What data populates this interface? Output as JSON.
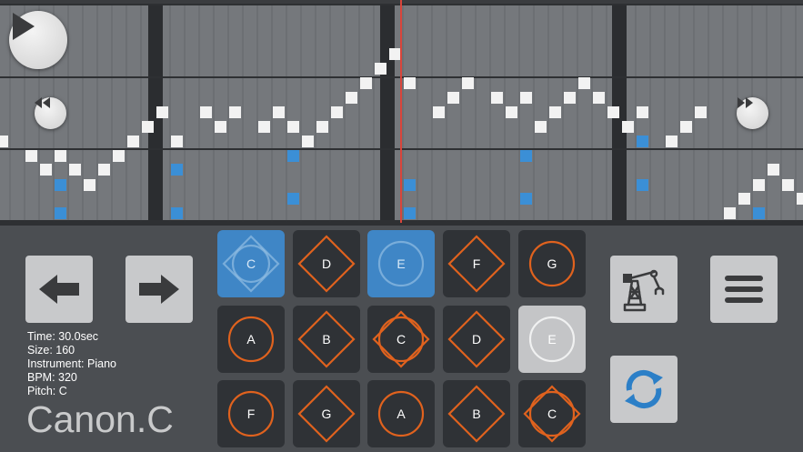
{
  "transport": {
    "play": "play-icon",
    "rewind": "rewind-icon",
    "fast_forward": "fast-forward-icon"
  },
  "colors": {
    "roll_bg": "#6a6d71",
    "white_note": "#f2f2f2",
    "blue_note": "#3b8fd6",
    "playhead": "#d9453b",
    "pad_orange": "#e0621e",
    "pad_blue": "#3f86c6"
  },
  "info": {
    "time": "Time: 30.0sec",
    "size": "Size: 160",
    "instrument": "Instrument: Piano",
    "bpm": "BPM: 320",
    "pitch": "Pitch: C"
  },
  "song_title": "Canon.C",
  "nav": {
    "prev": "arrow-left-icon",
    "next": "arrow-right-icon"
  },
  "pads": [
    {
      "label": "C",
      "shape": "both",
      "state": "active"
    },
    {
      "label": "D",
      "shape": "diamond",
      "state": "normal"
    },
    {
      "label": "E",
      "shape": "circle",
      "state": "active"
    },
    {
      "label": "F",
      "shape": "diamond",
      "state": "normal"
    },
    {
      "label": "G",
      "shape": "circle",
      "state": "normal"
    },
    {
      "label": "A",
      "shape": "circle",
      "state": "normal"
    },
    {
      "label": "B",
      "shape": "diamond",
      "state": "normal"
    },
    {
      "label": "C",
      "shape": "both",
      "state": "normal"
    },
    {
      "label": "D",
      "shape": "diamond",
      "state": "normal"
    },
    {
      "label": "E",
      "shape": "circle",
      "state": "light"
    },
    {
      "label": "F",
      "shape": "circle",
      "state": "normal"
    },
    {
      "label": "G",
      "shape": "diamond",
      "state": "normal"
    },
    {
      "label": "A",
      "shape": "circle",
      "state": "normal"
    },
    {
      "label": "B",
      "shape": "diamond",
      "state": "normal"
    },
    {
      "label": "C",
      "shape": "both",
      "state": "normal"
    }
  ],
  "tools": {
    "auto_play": "robot-arm-icon",
    "menu": "hamburger-menu-icon",
    "refresh": "refresh-icon"
  }
}
